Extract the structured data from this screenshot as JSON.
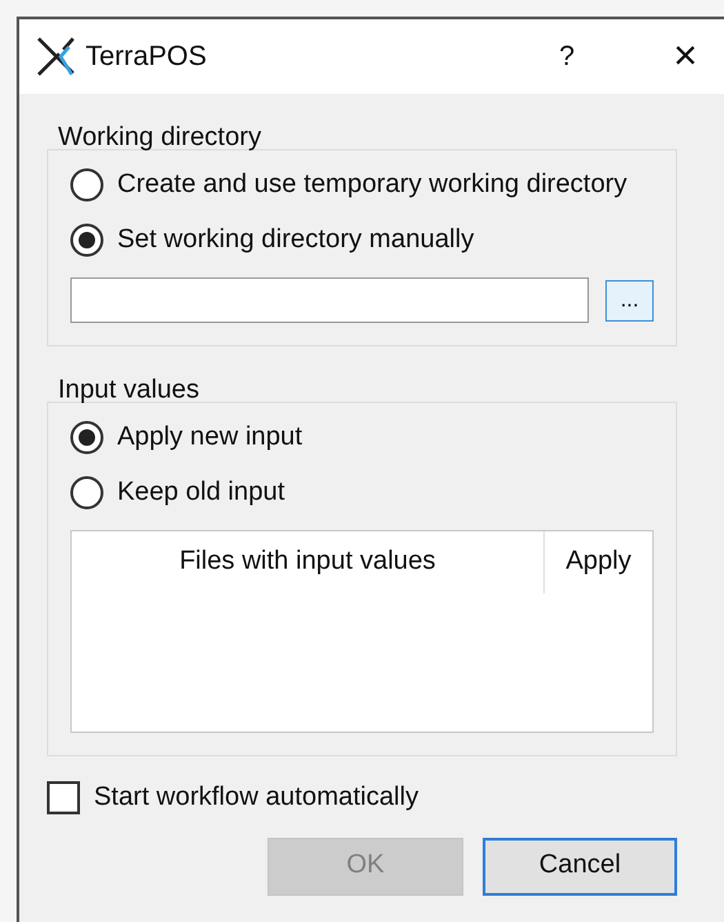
{
  "window": {
    "title": "TerraPOS",
    "help": "?",
    "close": "×"
  },
  "working_directory": {
    "title": "Working directory",
    "options": [
      {
        "label": "Create and use temporary working directory",
        "selected": false
      },
      {
        "label": "Set working directory manually",
        "selected": true
      }
    ],
    "browse": "..."
  },
  "input_values": {
    "title": "Input values",
    "options": [
      {
        "label": "Apply new input",
        "selected": true
      },
      {
        "label": "Keep old input",
        "selected": false
      }
    ],
    "table": {
      "columns": [
        "Files with input values",
        "Apply"
      ]
    }
  },
  "start_automatically": {
    "label": "Start workflow automatically",
    "checked": false
  },
  "buttons": [
    {
      "label": "OK",
      "disabled": true
    },
    {
      "label": "Cancel",
      "disabled": false
    }
  ]
}
